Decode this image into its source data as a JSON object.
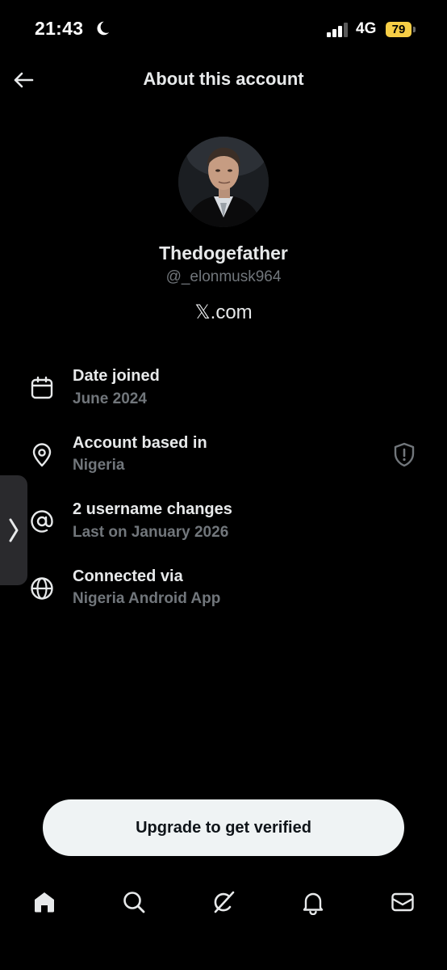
{
  "status_bar": {
    "time": "21:43",
    "network": "4G",
    "battery": "79"
  },
  "header": {
    "title": "About this account"
  },
  "profile": {
    "display_name": "Thedogefather",
    "handle": "@_elonmusk964",
    "site": "𝕏.com"
  },
  "details": [
    {
      "icon": "calendar-icon",
      "title": "Date joined",
      "value": "June 2024"
    },
    {
      "icon": "location-pin-icon",
      "title": "Account based in",
      "value": "Nigeria"
    },
    {
      "icon": "at-sign-icon",
      "title": "2 username changes",
      "value": "Last on January 2026"
    },
    {
      "icon": "globe-icon",
      "title": "Connected via",
      "value": "Nigeria Android App"
    }
  ],
  "upgrade": {
    "label": "Upgrade to get verified"
  },
  "colors": {
    "background": "#000000",
    "primary_text": "#e7e9ea",
    "secondary_text": "#71767b",
    "battery": "#f7ce46",
    "button_bg": "#eff3f4"
  },
  "bottom_nav": [
    "home-icon",
    "search-icon",
    "grok-icon",
    "notifications-icon",
    "messages-icon"
  ]
}
